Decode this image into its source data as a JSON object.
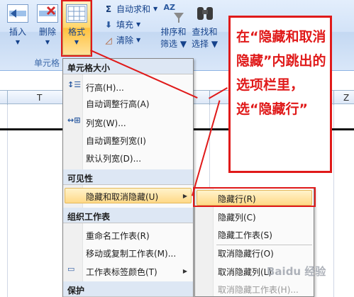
{
  "ribbon": {
    "insert_label": "插入",
    "delete_label": "删除",
    "format_label": "格式",
    "cells_group_label": "单元格",
    "autosum_label": "自动求和",
    "fill_label": "填充",
    "clear_label": "清除",
    "sort_filter_label": "排序和",
    "sort_filter_label2": "筛选",
    "find_select_label": "查找和",
    "find_select_label2": "选择",
    "sigma": "Σ",
    "sort_icon_letters": "AZ"
  },
  "sheet": {
    "columns": [
      "T",
      "X",
      "Z"
    ]
  },
  "menu": {
    "section_cell_size": "单元格大小",
    "row_height": "行高(H)...",
    "autofit_row": "自动调整行高(A)",
    "col_width": "列宽(W)...",
    "autofit_col": "自动调整列宽(I)",
    "default_width": "默认列宽(D)...",
    "section_visibility": "可见性",
    "hide_unhide": "隐藏和取消隐藏(U)",
    "section_organize": "组织工作表",
    "rename_sheet": "重命名工作表(R)",
    "move_copy": "移动或复制工作表(M)...",
    "tab_color": "工作表标签颜色(T)",
    "section_protect": "保护"
  },
  "submenu": {
    "hide_rows": "隐藏行(R)",
    "hide_cols": "隐藏列(C)",
    "hide_sheet": "隐藏工作表(S)",
    "unhide_rows": "取消隐藏行(O)",
    "unhide_cols": "取消隐藏列(L)",
    "unhide_sheet": "取消隐藏工作表(H)..."
  },
  "annotation": {
    "text": "在“隐藏和取消隐藏”内跳出的选项栏里，选“隐藏行”"
  },
  "watermark": "Baidu 经验",
  "colors": {
    "annotation_red": "#e01a1a",
    "highlight_orange": "#ffd987",
    "ribbon_blue": "#d3e3f8"
  }
}
